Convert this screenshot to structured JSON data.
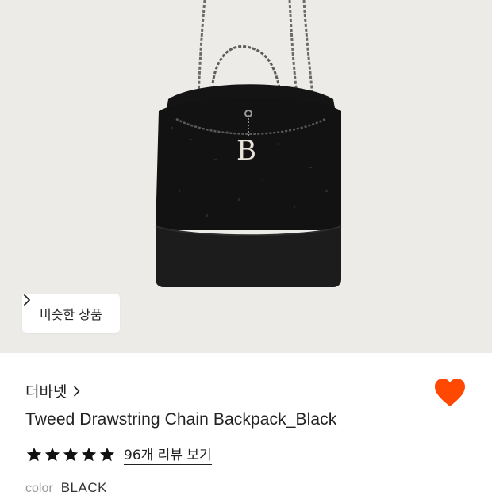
{
  "product_image": {
    "alt": "Tweed Drawstring Chain Backpack",
    "charm_letter": "B"
  },
  "similar_button": {
    "label": "비슷한 상품"
  },
  "brand": {
    "name": "더바넷"
  },
  "product": {
    "title": "Tweed Drawstring Chain Backpack_Black",
    "rating_stars": 5,
    "review_link": "96개 리뷰 보기",
    "color_label": "color",
    "color_value": "BLACK"
  },
  "colors": {
    "heart": "#ff4800",
    "star": "#111111",
    "hero_bg": "#ecebe7"
  },
  "icons": {
    "wishlist": "heart-icon",
    "rating": "star-icon",
    "chevron": "chevron-right-icon"
  }
}
